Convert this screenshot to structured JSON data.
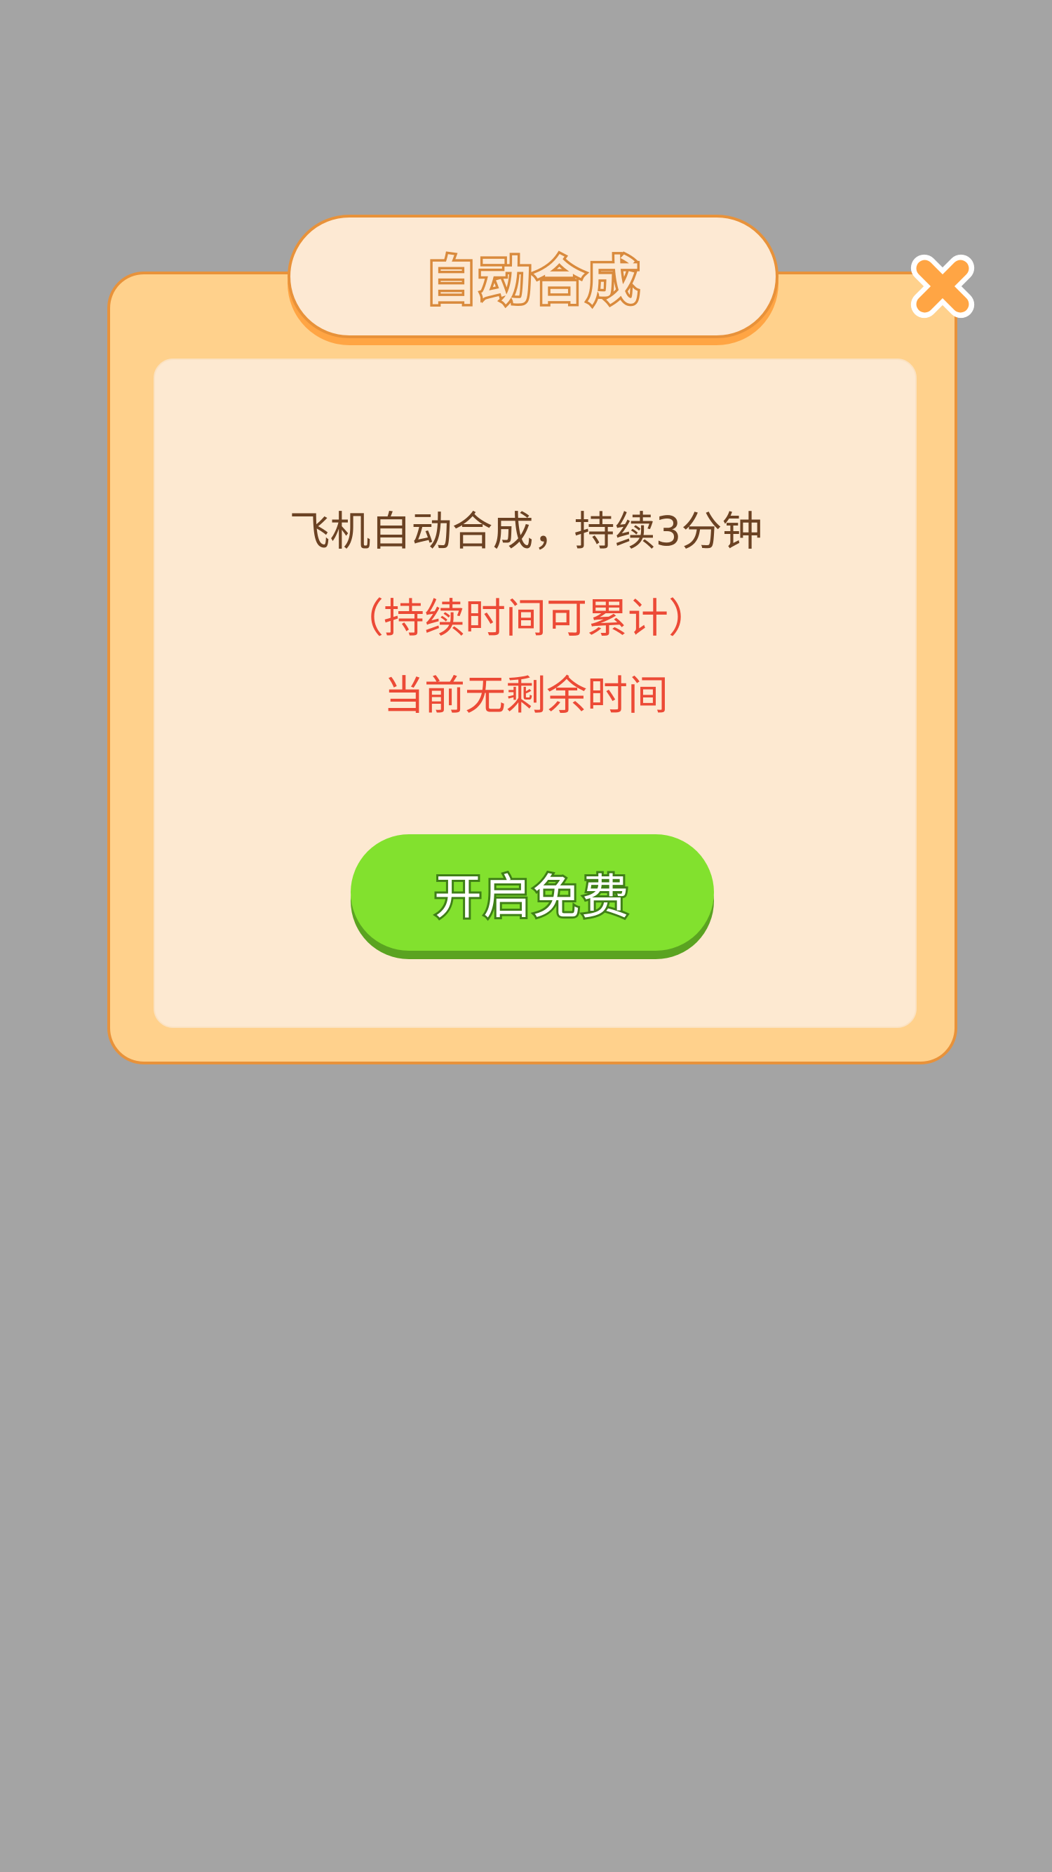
{
  "dialog": {
    "title": "自动合成",
    "close_icon": "close-icon",
    "description": "飞机自动合成，持续3分钟",
    "note": "（持续时间可累计）",
    "remaining": "当前无剩余时间",
    "button_label": "开启免费"
  },
  "colors": {
    "overlay": "#a4a4a4",
    "panel": "#ffd18c",
    "panel_border": "#e8923a",
    "inner_panel": "#fde9d1",
    "accent_orange": "#ffa544",
    "description_text": "#6b4223",
    "alert_text": "#ec4a36",
    "button_green": "#82e12e",
    "button_shadow": "#5aa321"
  }
}
